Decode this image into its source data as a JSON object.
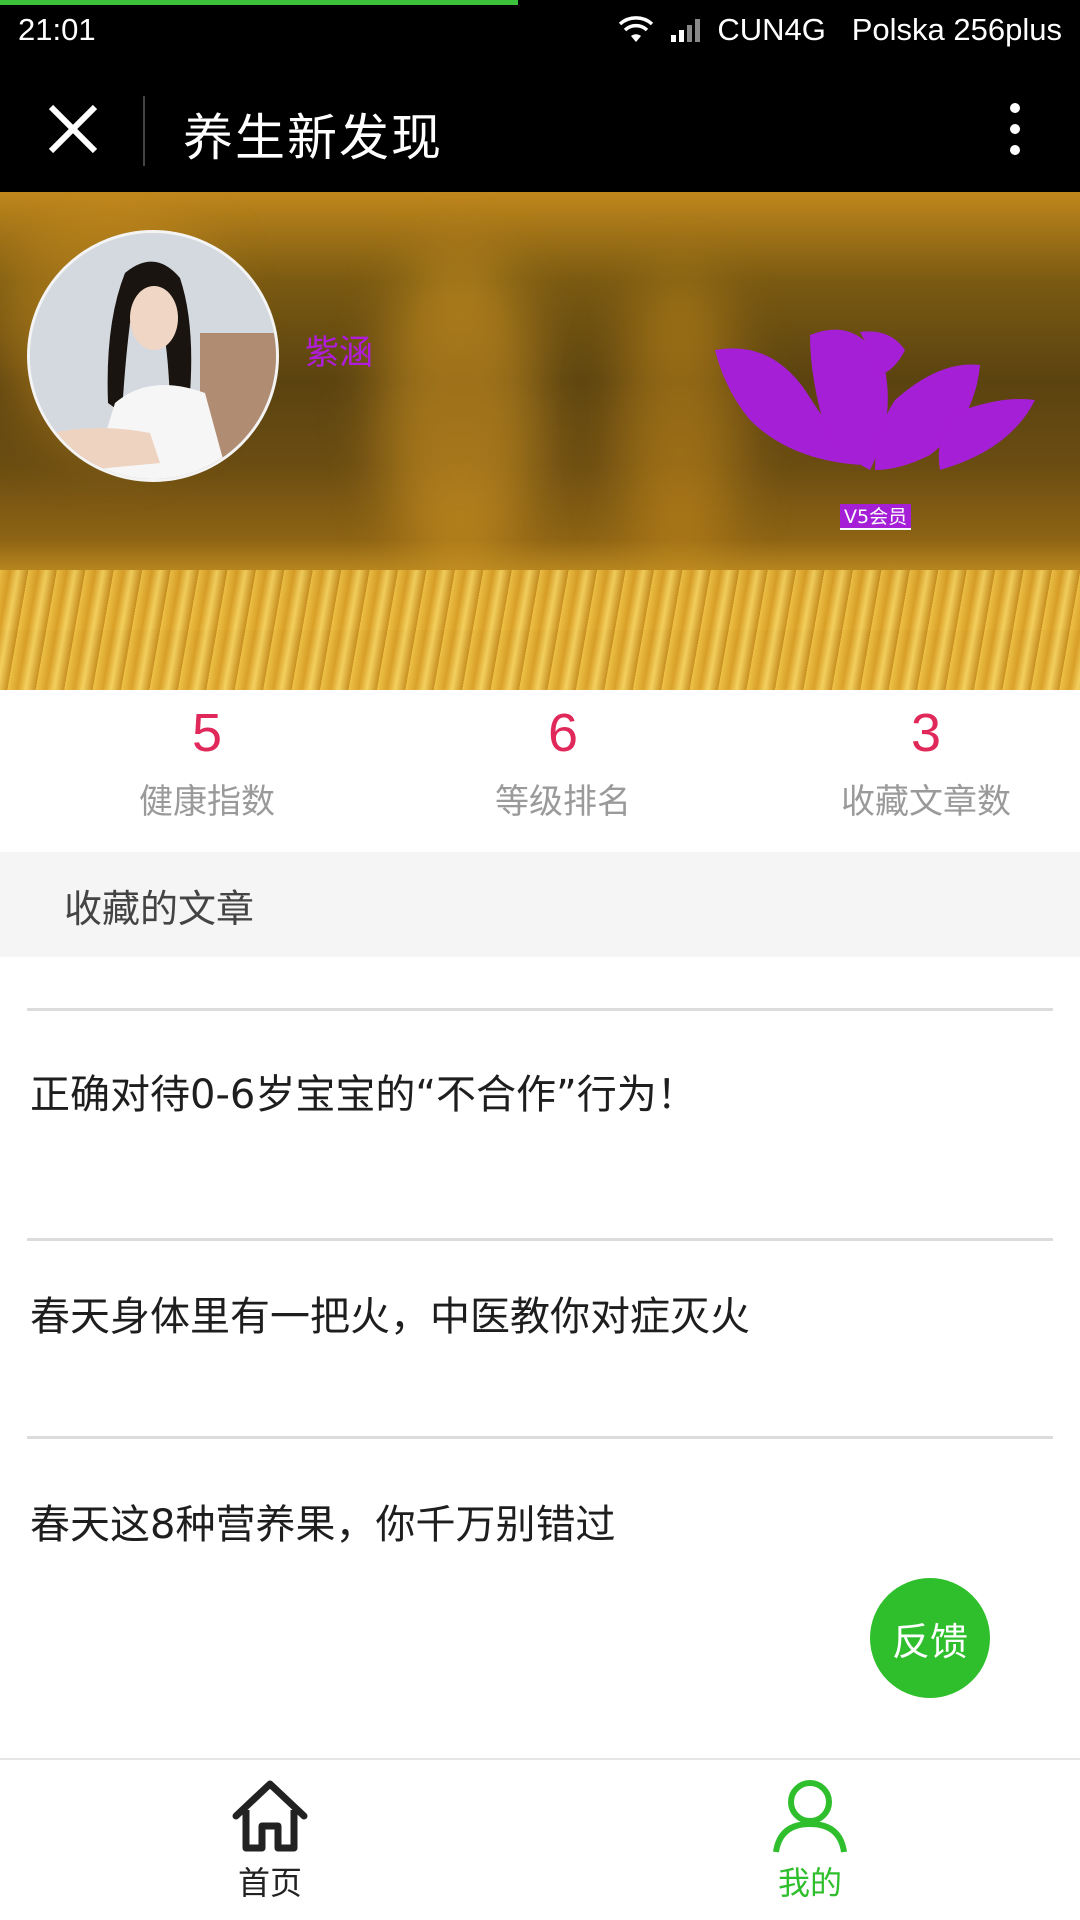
{
  "status_bar": {
    "time": "21:01",
    "carrier_text": "CUN4G   Polska 256plus",
    "load_progress": 0.48,
    "icons": [
      "wifi-icon",
      "signal-icon"
    ]
  },
  "title_bar": {
    "title": "养生新发现",
    "close_icon": "close-icon",
    "more_icon": "more-vertical-icon"
  },
  "profile": {
    "name": "紫涵",
    "badge": "V5会员",
    "name_color": "#b01cd9",
    "lotus_color": "#a51fd6"
  },
  "stats": [
    {
      "value": "5",
      "label": "健康指数"
    },
    {
      "value": "6",
      "label": "等级排名"
    },
    {
      "value": "3",
      "label": "收藏文章数"
    }
  ],
  "section": {
    "title": "收藏的文章"
  },
  "articles": [
    {
      "title": "正确对待0-6岁宝宝的“不合作”行为！"
    },
    {
      "title": "春天身体里有一把火，中医教你对症灭火"
    },
    {
      "title": "春天这8种营养果，你千万别错过"
    }
  ],
  "feedback": {
    "label": "反馈",
    "color": "#2fbf2c"
  },
  "tab_bar": {
    "tabs": [
      {
        "label": "首页",
        "icon": "home-icon",
        "active": false
      },
      {
        "label": "我的",
        "icon": "user-icon",
        "active": true
      }
    ],
    "active_color": "#2fbf2c",
    "inactive_color": "#222222"
  }
}
